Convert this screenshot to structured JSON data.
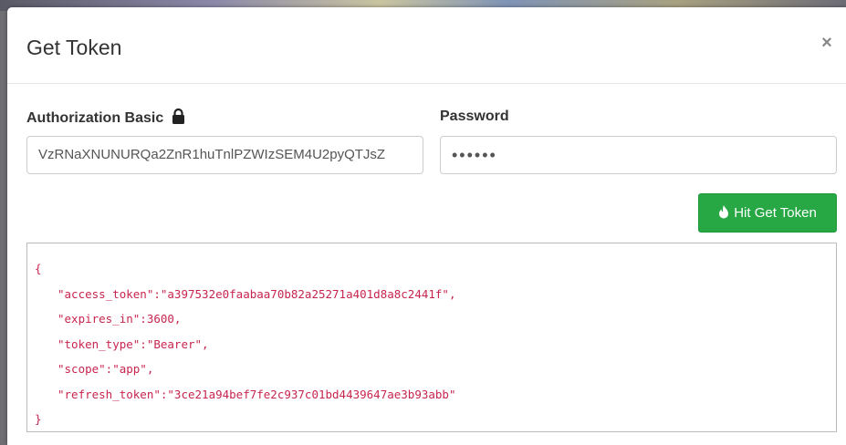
{
  "modal": {
    "title": "Get Token",
    "close_label": "×"
  },
  "form": {
    "auth_label": "Authorization Basic",
    "auth_value": "VzRNaXNUNURQa2ZnR1huTnlPZWIzSEM4U2pyQTJsZ",
    "password_label": "Password",
    "password_value": "••••••"
  },
  "actions": {
    "get_token_label": "Hit Get Token"
  },
  "response": {
    "open_brace": "{",
    "lines": [
      "\"access_token\":\"a397532e0faabaa70b82a25271a401d8a8c2441f\",",
      "\"expires_in\":3600,",
      "\"token_type\":\"Bearer\",",
      "\"scope\":\"app\",",
      "\"refresh_token\":\"3ce21a94bef7fe2c937c01bd4439647ae3b93abb\""
    ],
    "close_brace": "}"
  },
  "colors": {
    "button_green": "#27a844",
    "code_pink": "#c7254e"
  },
  "icons": {
    "lock": "lock-icon",
    "fire": "fire-icon",
    "close": "close-icon"
  }
}
